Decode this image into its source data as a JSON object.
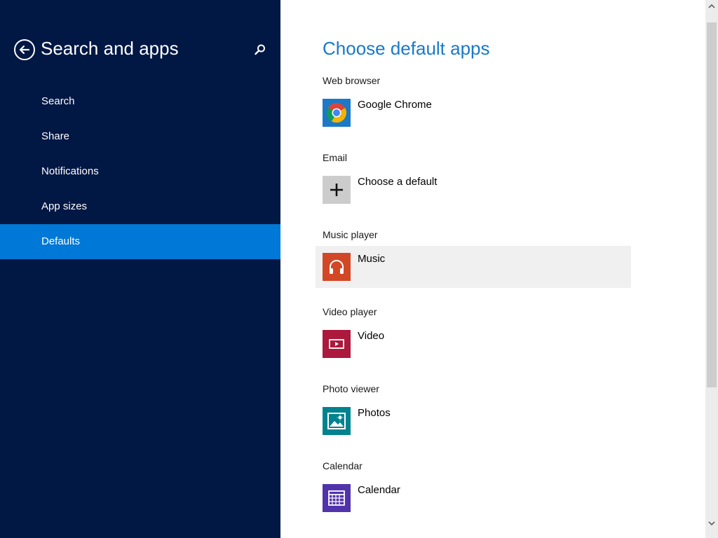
{
  "nav": {
    "title": "Search and apps",
    "back_icon": "back-arrow-icon",
    "search_icon": "search-icon",
    "background_color": "#011744",
    "selected_color": "#0078d7",
    "items": [
      {
        "label": "Search",
        "selected": false
      },
      {
        "label": "Share",
        "selected": false
      },
      {
        "label": "Notifications",
        "selected": false
      },
      {
        "label": "App sizes",
        "selected": false
      },
      {
        "label": "Defaults",
        "selected": true
      }
    ]
  },
  "main": {
    "title": "Choose default apps",
    "title_color": "#1979ca",
    "sections": [
      {
        "label": "Web browser",
        "app": "Google Chrome",
        "icon": "chrome-icon",
        "tile_color": "#1c79c7"
      },
      {
        "label": "Email",
        "app": "Choose a default",
        "icon": "plus-icon",
        "tile_color": "#cccccc"
      },
      {
        "label": "Music player",
        "app": "Music",
        "icon": "headphones-icon",
        "tile_color": "#d24726",
        "hovered": true
      },
      {
        "label": "Video player",
        "app": "Video",
        "icon": "video-icon",
        "tile_color": "#ac193d"
      },
      {
        "label": "Photo viewer",
        "app": "Photos",
        "icon": "photo-icon",
        "tile_color": "#00838f"
      },
      {
        "label": "Calendar",
        "app": "Calendar",
        "icon": "calendar-icon",
        "tile_color": "#5133ab"
      }
    ]
  },
  "scrollbar": {
    "visible_fraction": 0.74
  }
}
